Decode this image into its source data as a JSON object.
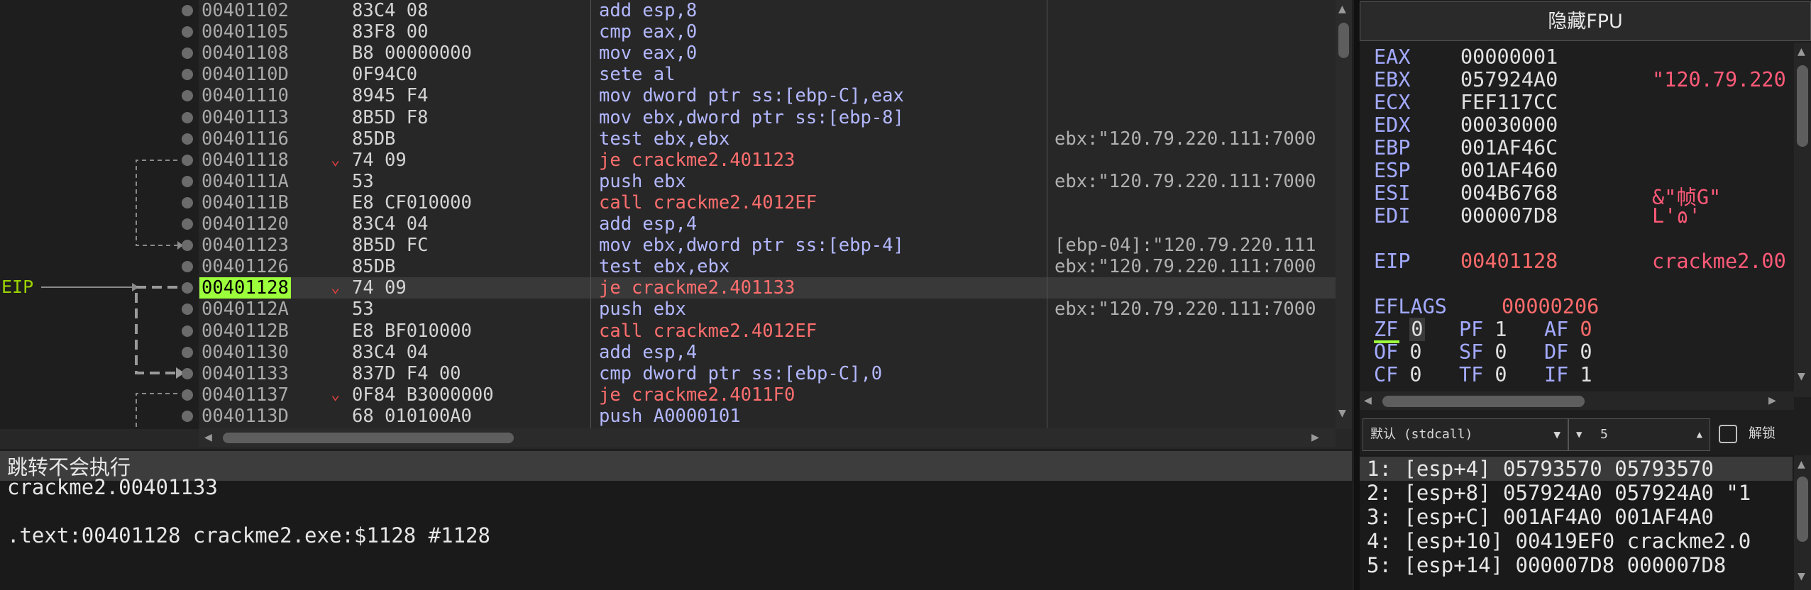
{
  "eip_label": "EIP",
  "disasm": {
    "rows": [
      {
        "addr": "00401102",
        "bytes": "83C4 08",
        "instr": "add esp,8",
        "comment": "",
        "jump": false,
        "current": false,
        "arrow": ""
      },
      {
        "addr": "00401105",
        "bytes": "83F8 00",
        "instr": "cmp eax,0",
        "comment": "",
        "jump": false,
        "current": false,
        "arrow": ""
      },
      {
        "addr": "00401108",
        "bytes": "B8 00000000",
        "instr": "mov eax,0",
        "comment": "",
        "jump": false,
        "current": false,
        "arrow": ""
      },
      {
        "addr": "0040110D",
        "bytes": "0F94C0",
        "instr": "sete al",
        "comment": "",
        "jump": false,
        "current": false,
        "arrow": ""
      },
      {
        "addr": "00401110",
        "bytes": "8945 F4",
        "instr": "mov dword ptr ss:[ebp-C],eax",
        "comment": "",
        "jump": false,
        "current": false,
        "arrow": ""
      },
      {
        "addr": "00401113",
        "bytes": "8B5D F8",
        "instr": "mov ebx,dword ptr ss:[ebp-8]",
        "comment": "",
        "jump": false,
        "current": false,
        "arrow": ""
      },
      {
        "addr": "00401116",
        "bytes": "85DB",
        "instr": "test ebx,ebx",
        "comment": "ebx:\"120.79.220.111:7000",
        "jump": false,
        "current": false,
        "arrow": ""
      },
      {
        "addr": "00401118",
        "bytes": "74 09",
        "instr": "je crackme2.401123",
        "comment": "",
        "jump": true,
        "current": false,
        "arrow": "⌄"
      },
      {
        "addr": "0040111A",
        "bytes": "53",
        "instr": "push ebx",
        "comment": "ebx:\"120.79.220.111:7000",
        "jump": false,
        "current": false,
        "arrow": ""
      },
      {
        "addr": "0040111B",
        "bytes": "E8 CF010000",
        "instr": "call crackme2.4012EF",
        "comment": "",
        "jump": true,
        "current": false,
        "arrow": ""
      },
      {
        "addr": "00401120",
        "bytes": "83C4 04",
        "instr": "add esp,4",
        "comment": "",
        "jump": false,
        "current": false,
        "arrow": ""
      },
      {
        "addr": "00401123",
        "bytes": "8B5D FC",
        "instr": "mov ebx,dword ptr ss:[ebp-4]",
        "comment": "[ebp-04]:\"120.79.220.111",
        "jump": false,
        "current": false,
        "arrow": ""
      },
      {
        "addr": "00401126",
        "bytes": "85DB",
        "instr": "test ebx,ebx",
        "comment": "ebx:\"120.79.220.111:7000",
        "jump": false,
        "current": false,
        "arrow": ""
      },
      {
        "addr": "00401128",
        "bytes": "74 09",
        "instr": "je crackme2.401133",
        "comment": "",
        "jump": true,
        "current": true,
        "arrow": "⌄"
      },
      {
        "addr": "0040112A",
        "bytes": "53",
        "instr": "push ebx",
        "comment": "ebx:\"120.79.220.111:7000",
        "jump": false,
        "current": false,
        "arrow": ""
      },
      {
        "addr": "0040112B",
        "bytes": "E8 BF010000",
        "instr": "call crackme2.4012EF",
        "comment": "",
        "jump": true,
        "current": false,
        "arrow": ""
      },
      {
        "addr": "00401130",
        "bytes": "83C4 04",
        "instr": "add esp,4",
        "comment": "",
        "jump": false,
        "current": false,
        "arrow": ""
      },
      {
        "addr": "00401133",
        "bytes": "837D F4 00",
        "instr": "cmp dword ptr ss:[ebp-C],0",
        "comment": "",
        "jump": false,
        "current": false,
        "arrow": ""
      },
      {
        "addr": "00401137",
        "bytes": "0F84 B3000000",
        "instr": "je crackme2.4011F0",
        "comment": "",
        "jump": true,
        "current": false,
        "arrow": "⌄"
      },
      {
        "addr": "0040113D",
        "bytes": "68 010100A0",
        "instr": "push A0000101",
        "comment": "",
        "jump": false,
        "current": false,
        "arrow": ""
      }
    ]
  },
  "info": {
    "lines": [
      "跳转不会执行",
      "crackme2.00401133",
      "",
      ".text:00401128 crackme2.exe:$1128 #1128"
    ]
  },
  "registers": {
    "fpu_button": "隐藏FPU",
    "gp": [
      {
        "name": "EAX",
        "value": "00000001",
        "comment": "",
        "changed": false
      },
      {
        "name": "EBX",
        "value": "057924A0",
        "comment": "\"120.79.220",
        "changed": false
      },
      {
        "name": "ECX",
        "value": "FEF117CC",
        "comment": "",
        "changed": false
      },
      {
        "name": "EDX",
        "value": "00030000",
        "comment": "",
        "changed": false
      },
      {
        "name": "EBP",
        "value": "001AF46C",
        "comment": "",
        "changed": false
      },
      {
        "name": "ESP",
        "value": "001AF460",
        "comment": "",
        "changed": false
      },
      {
        "name": "ESI",
        "value": "004B6768",
        "comment": "&\"帧G\"",
        "changed": false
      },
      {
        "name": "EDI",
        "value": "000007D8",
        "comment": "L'ɷ'",
        "changed": false
      }
    ],
    "eip": {
      "name": "EIP",
      "value": "00401128",
      "comment": "crackme2.00",
      "changed": true
    },
    "eflags": {
      "name": "EFLAGS",
      "value": "00000206"
    },
    "flags": [
      [
        {
          "name": "ZF",
          "value": "0",
          "changed": false
        },
        {
          "name": "PF",
          "value": "1",
          "changed": false
        },
        {
          "name": "AF",
          "value": "0",
          "changed": true
        }
      ],
      [
        {
          "name": "OF",
          "value": "0",
          "changed": false
        },
        {
          "name": "SF",
          "value": "0",
          "changed": false
        },
        {
          "name": "DF",
          "value": "0",
          "changed": false
        }
      ],
      [
        {
          "name": "CF",
          "value": "0",
          "changed": false
        },
        {
          "name": "TF",
          "value": "0",
          "changed": false
        },
        {
          "name": "IF",
          "value": "1",
          "changed": false
        }
      ]
    ]
  },
  "controls": {
    "callconv": "默认 (stdcall)",
    "argcount": "5",
    "unlock_label": "解锁"
  },
  "stack": {
    "lines": [
      "1: [esp+4] 05793570 05793570",
      "2: [esp+8] 057924A0 057924A0 \"1",
      "3: [esp+C] 001AF4A0 001AF4A0",
      "4: [esp+10] 00419EF0 crackme2.0",
      "5: [esp+14] 000007D8 000007D8"
    ]
  }
}
